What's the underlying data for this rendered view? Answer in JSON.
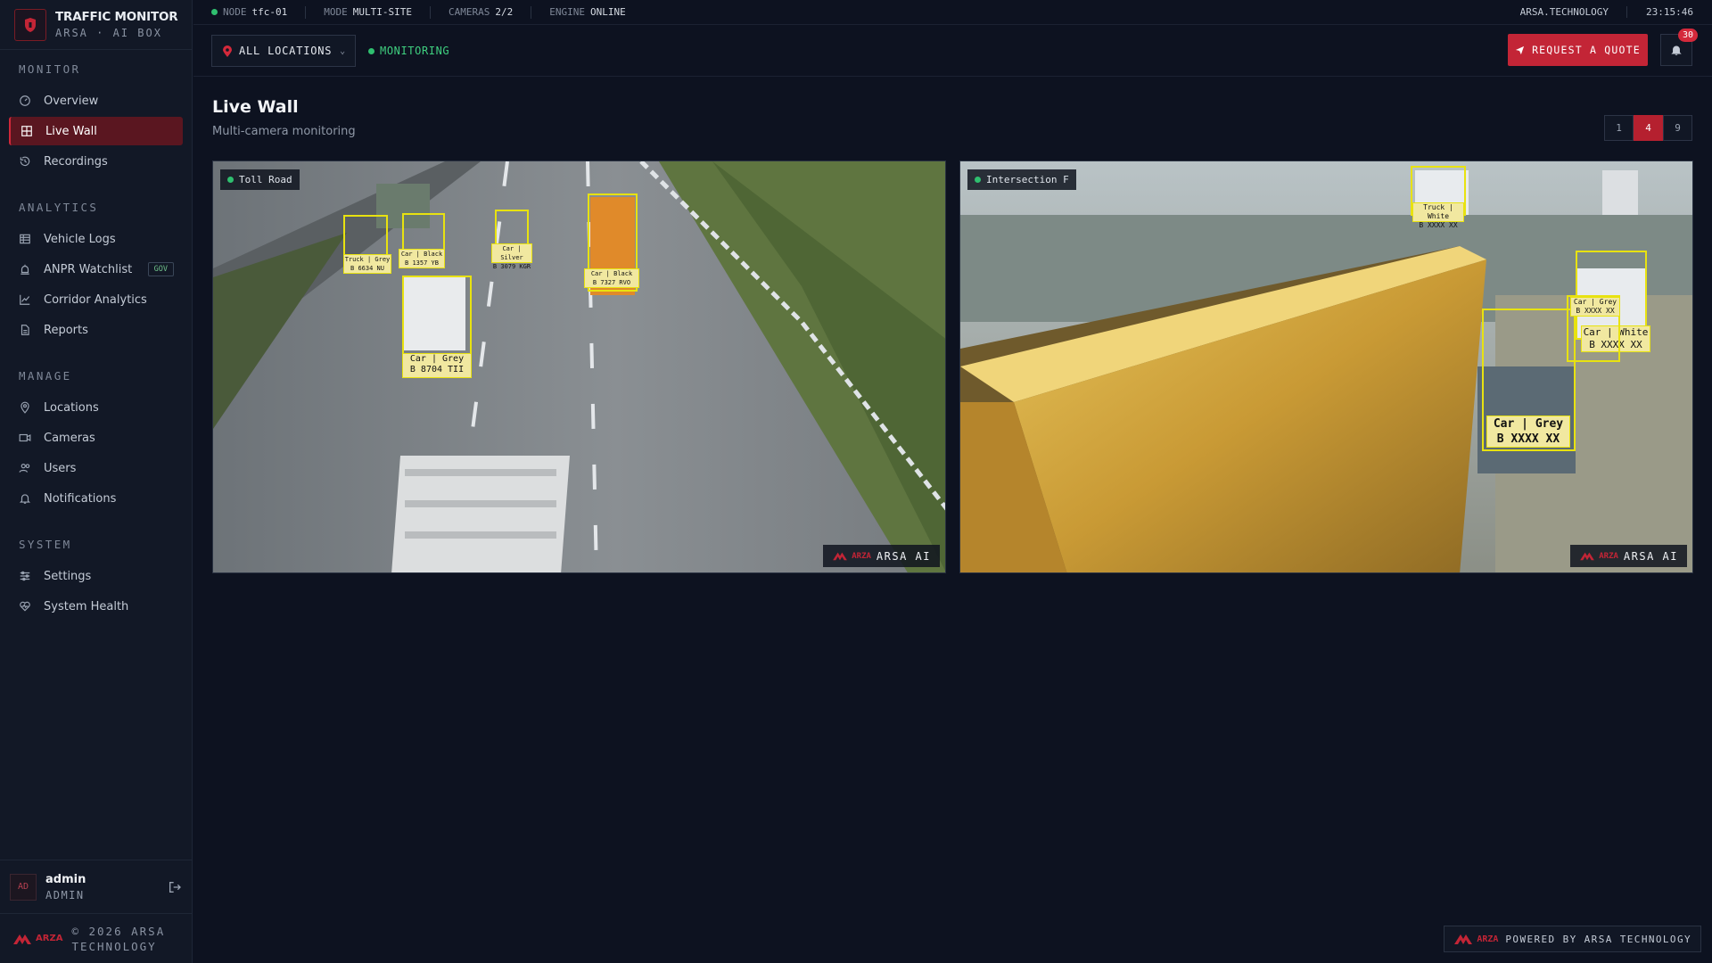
{
  "brand": {
    "title": "TRAFFIC MONITOR",
    "subtitle": "ARSA · AI BOX",
    "mini_logo": "ARZA"
  },
  "status_bar": {
    "node_label": "NODE",
    "node_value": "tfc-01",
    "mode_label": "MODE",
    "mode_value": "MULTI-SITE",
    "cameras_label": "CAMERAS",
    "cameras_value": "2/2",
    "engine_label": "ENGINE",
    "engine_value": "ONLINE",
    "site": "ARSA.TECHNOLOGY",
    "clock": "23:15:46"
  },
  "toolbar": {
    "location": "ALL LOCATIONS",
    "monitoring": "MONITORING",
    "quote_label": "REQUEST A QUOTE",
    "notification_count": "30"
  },
  "sidebar": {
    "sections": [
      {
        "title": "MONITOR",
        "items": [
          {
            "label": "Overview",
            "icon": "gauge-icon"
          },
          {
            "label": "Live Wall",
            "icon": "grid-icon",
            "active": true
          },
          {
            "label": "Recordings",
            "icon": "history-icon"
          }
        ]
      },
      {
        "title": "ANALYTICS",
        "items": [
          {
            "label": "Vehicle Logs",
            "icon": "table-icon"
          },
          {
            "label": "ANPR Watchlist",
            "icon": "alarm-icon",
            "badge": "GOV"
          },
          {
            "label": "Corridor Analytics",
            "icon": "chart-icon"
          },
          {
            "label": "Reports",
            "icon": "file-icon"
          }
        ]
      },
      {
        "title": "MANAGE",
        "items": [
          {
            "label": "Locations",
            "icon": "pin-icon"
          },
          {
            "label": "Cameras",
            "icon": "video-icon"
          },
          {
            "label": "Users",
            "icon": "users-icon"
          },
          {
            "label": "Notifications",
            "icon": "bell-icon"
          }
        ]
      },
      {
        "title": "SYSTEM",
        "items": [
          {
            "label": "Settings",
            "icon": "sliders-icon"
          },
          {
            "label": "System Health",
            "icon": "heart-icon"
          }
        ]
      }
    ]
  },
  "user": {
    "initials": "AD",
    "name": "admin",
    "role": "ADMIN"
  },
  "footer": {
    "copyright_line1": "© 2026 ARSA",
    "copyright_line2": "TECHNOLOGY",
    "powered": "POWERED BY ARSA TECHNOLOGY"
  },
  "page": {
    "title": "Live Wall",
    "subtitle": "Multi-camera monitoring"
  },
  "grid_options": [
    "1",
    "4",
    "9"
  ],
  "grid_selected": "4",
  "cameras": [
    {
      "name": "Toll Road",
      "watermark": "ARSA AI",
      "detections": [
        {
          "class": "Car | Grey",
          "plate": "B 8704 TII"
        },
        {
          "class": "Car | Black",
          "plate": "B 7327 RVO"
        },
        {
          "class": "Truck | Grey",
          "plate": "B 6634 NU"
        },
        {
          "class": "Car | Black",
          "plate": "B 1357 YB"
        },
        {
          "class": "Car | Silver",
          "plate": "B 3079 KGR"
        }
      ]
    },
    {
      "name": "Intersection F",
      "watermark": "ARSA AI",
      "detections": [
        {
          "class": "Car | Grey",
          "plate": "B XXXX XX"
        },
        {
          "class": "Car | White",
          "plate": "B XXXX XX"
        },
        {
          "class": "Car | Grey",
          "plate": "B XXXX XX"
        },
        {
          "class": "Truck | White",
          "plate": "B XXXX XX"
        }
      ]
    }
  ]
}
